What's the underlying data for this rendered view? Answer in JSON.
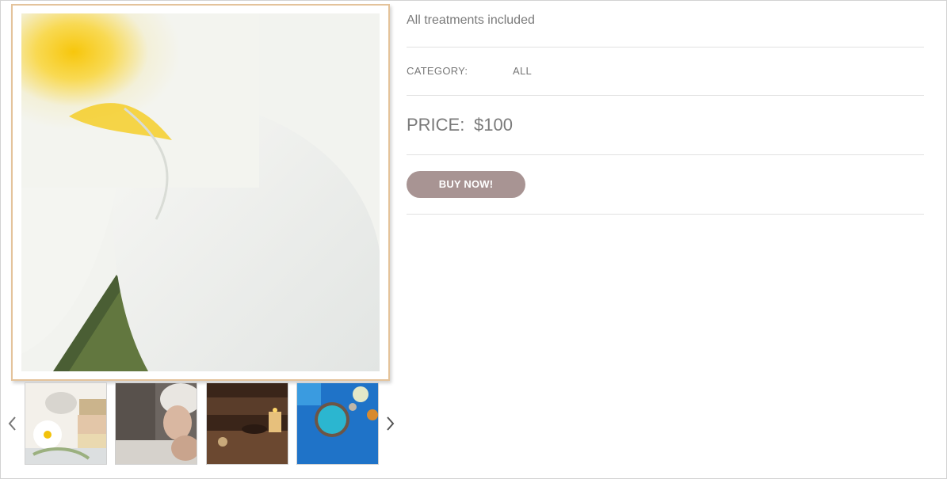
{
  "product": {
    "description": "All treatments included",
    "category_label": "CATEGORY:",
    "category_value": "ALL",
    "price_label": "PRICE:",
    "price_value": "$100",
    "buy_label": "BUY NOW!"
  },
  "gallery": {
    "main_image": "plumeria-flower",
    "thumbnails": [
      "spa-stones-flower",
      "woman-towel-spa",
      "candles-spa",
      "blue-bath-salt"
    ]
  },
  "colors": {
    "button": "#a89493",
    "main_image_border": "#e4c39b",
    "text": "#777777",
    "separator": "#e2e2e2"
  }
}
